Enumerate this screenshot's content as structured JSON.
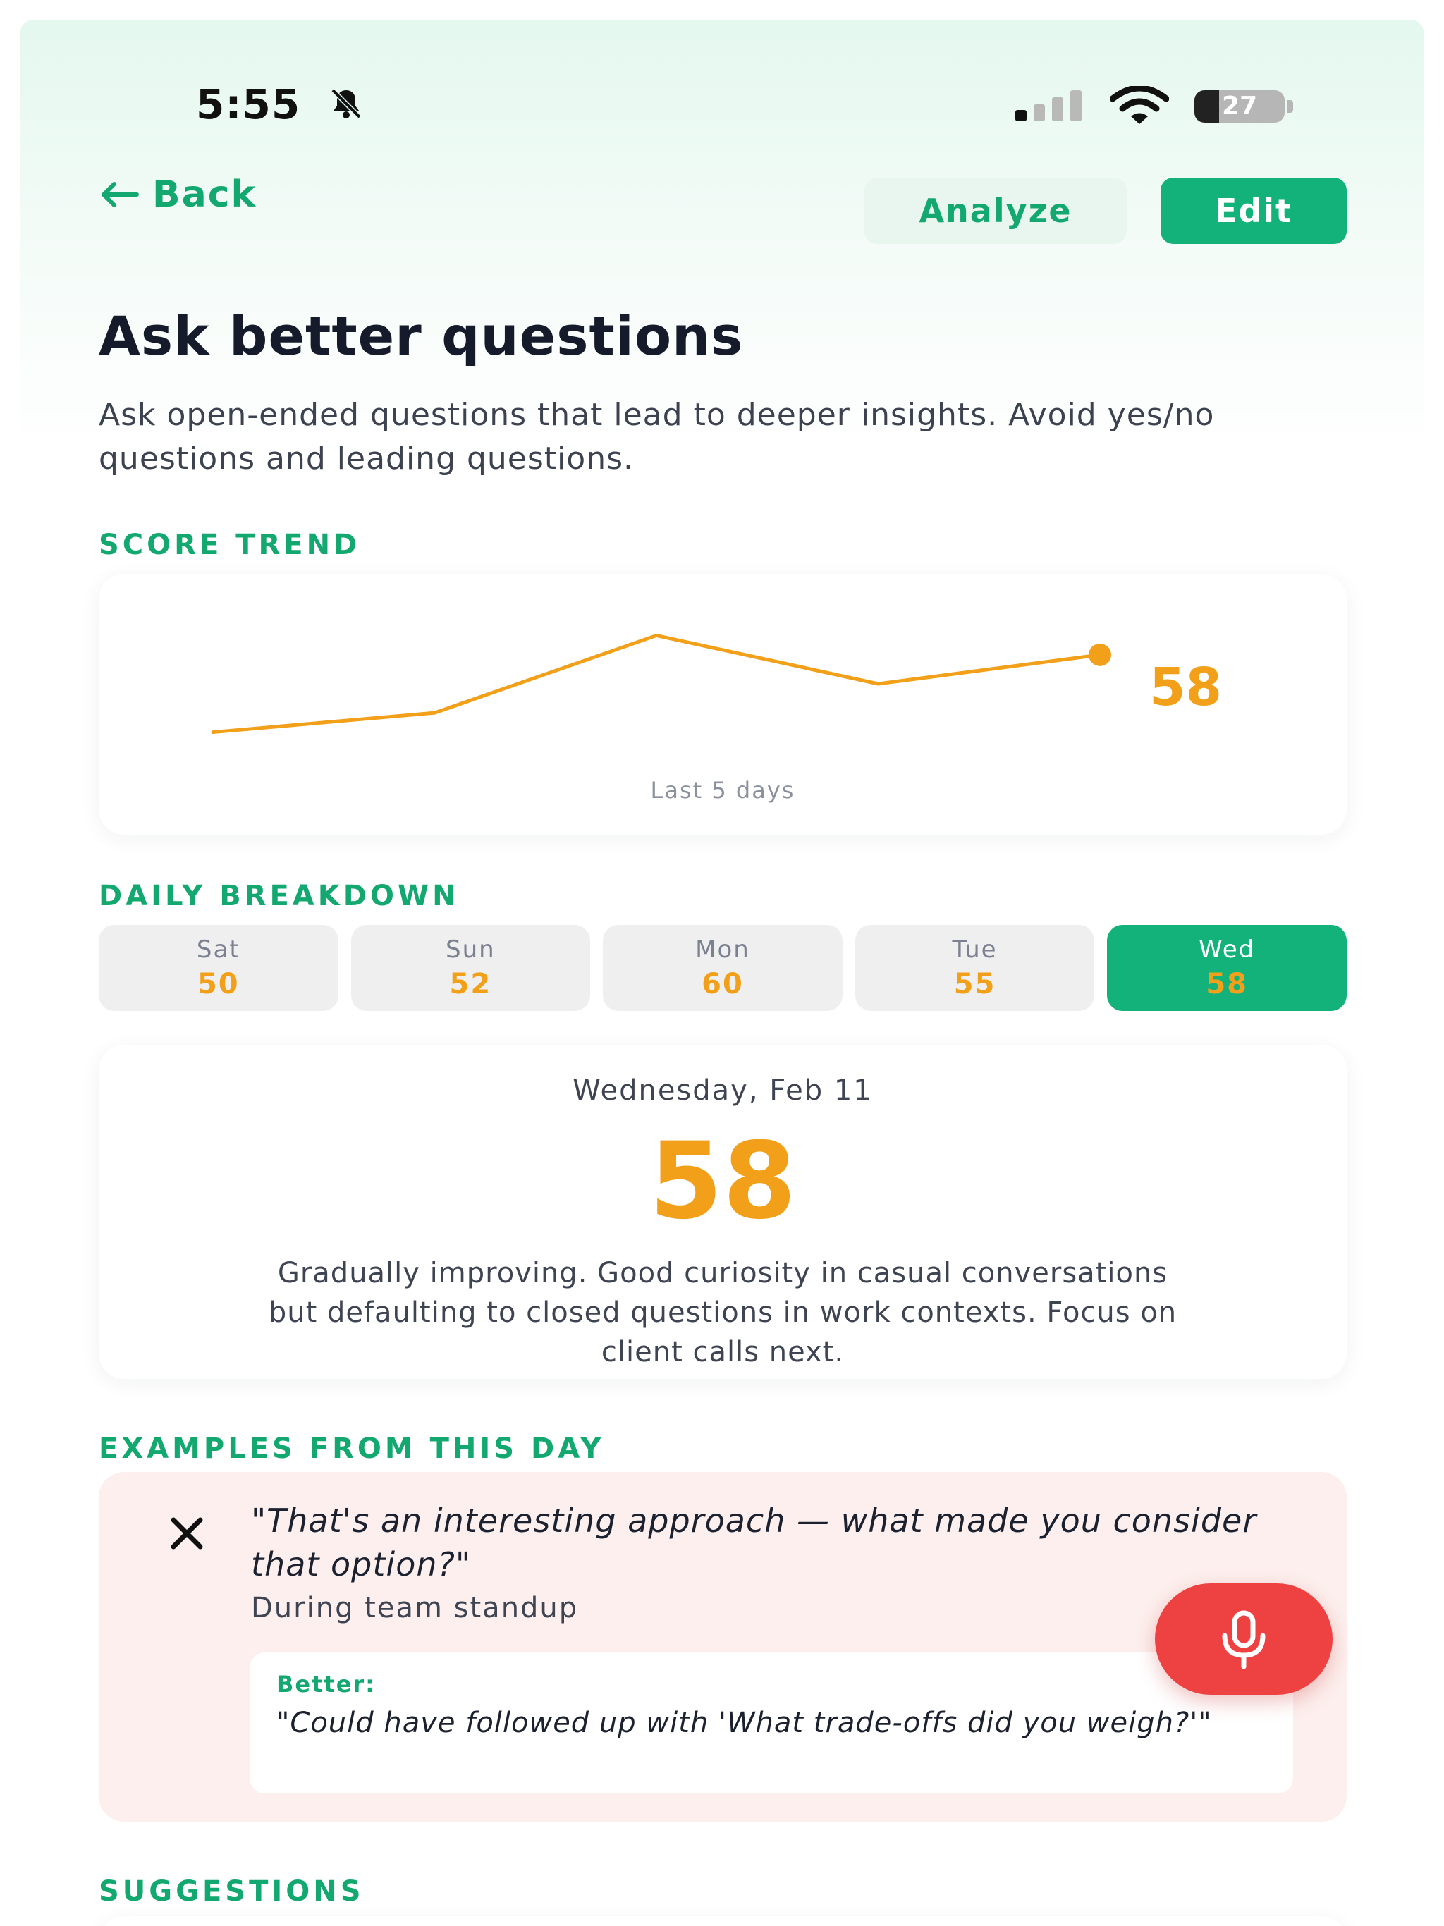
{
  "status_bar": {
    "time": "5:55",
    "battery_level": "27",
    "battery_fraction": 0.27,
    "icons": [
      "bell-slash-icon",
      "cellular-signal-icon",
      "wifi-icon",
      "battery-icon"
    ]
  },
  "header": {
    "back_label": "Back",
    "analyze_label": "Analyze",
    "edit_label": "Edit"
  },
  "skill": {
    "title": "Ask better questions",
    "description": "Ask open-ended questions that lead to deeper insights. Avoid yes/no questions and leading questions."
  },
  "score_trend": {
    "label": "SCORE TREND",
    "current_score": "58",
    "caption": "Last 5 days"
  },
  "chart_data": {
    "type": "line",
    "x": [
      "Sat",
      "Sun",
      "Mon",
      "Tue",
      "Wed"
    ],
    "series": [
      {
        "values": [
          50,
          52,
          60,
          55,
          58
        ]
      }
    ],
    "ylim": [
      48,
      62
    ],
    "grid": false,
    "line_color": "#f2a01a"
  },
  "daily_breakdown": {
    "label": "DAILY BREAKDOWN",
    "days": [
      {
        "name": "Sat",
        "score": "50",
        "active": false
      },
      {
        "name": "Sun",
        "score": "52",
        "active": false
      },
      {
        "name": "Mon",
        "score": "60",
        "active": false
      },
      {
        "name": "Tue",
        "score": "55",
        "active": false
      },
      {
        "name": "Wed",
        "score": "58",
        "active": true
      }
    ]
  },
  "day_detail": {
    "date": "Wednesday, Feb 11",
    "score": "58",
    "summary": "Gradually improving. Good curiosity in casual conversations but defaulting to closed questions in work contexts. Focus on client calls next."
  },
  "examples": {
    "label": "EXAMPLES FROM THIS DAY",
    "items": [
      {
        "quote": "\"That's an interesting approach — what made you consider that option?\"",
        "context": "During team standup",
        "better_label": "Better:",
        "better_text": "\"Could have followed up with 'What trade-offs did you weigh?'\""
      }
    ]
  },
  "suggestions": {
    "label": "SUGGESTIONS"
  },
  "colors": {
    "accent": "#13b27a",
    "score": "#f2a01a",
    "mic": "#ee4141",
    "example_bg": "#fcefed"
  }
}
